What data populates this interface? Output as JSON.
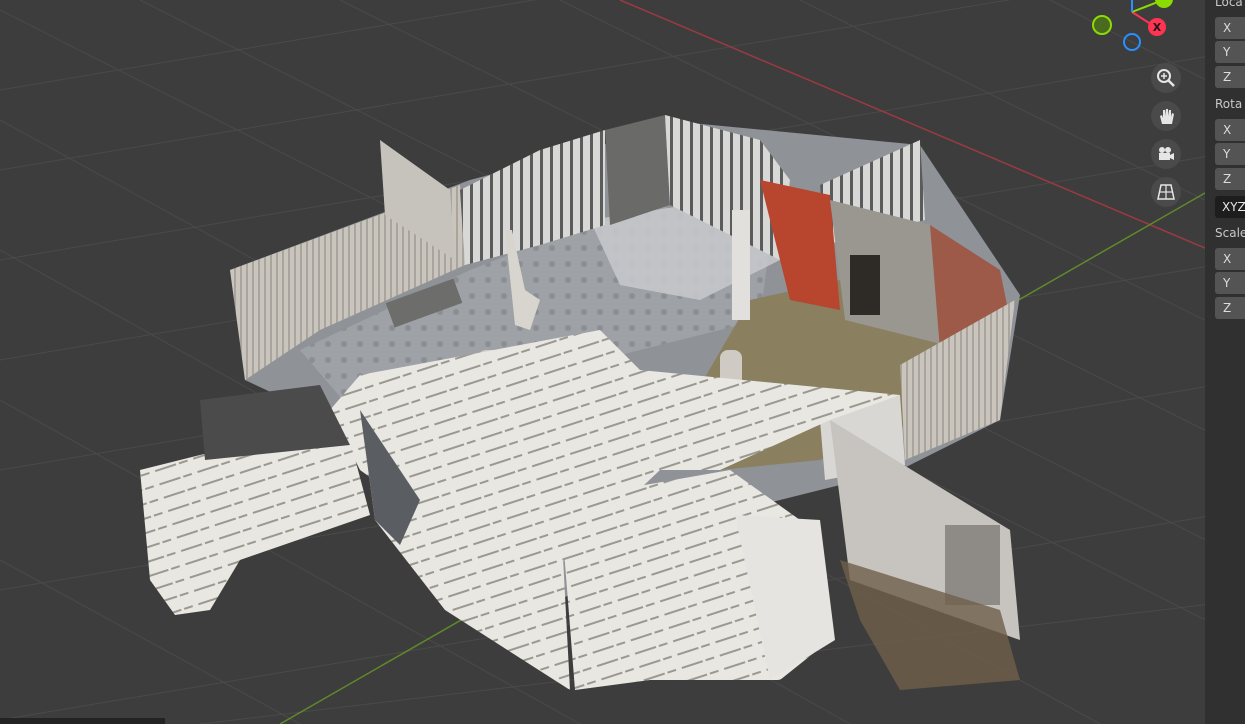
{
  "gizmo": {
    "x_axis_label": "X",
    "colors": {
      "x": "#ff3352",
      "y": "#8bdc00",
      "z": "#2890ff"
    }
  },
  "nav_buttons": [
    {
      "icon": "zoom-icon",
      "glyph": "⊕"
    },
    {
      "icon": "hand-pan-icon",
      "glyph": "✋"
    },
    {
      "icon": "camera-icon",
      "glyph": "🎥"
    },
    {
      "icon": "grid-ortho-icon",
      "glyph": "▦"
    }
  ],
  "properties": {
    "location": {
      "label": "Loca",
      "fields": [
        "X",
        "Y",
        "Z"
      ]
    },
    "rotation": {
      "label": "Rota",
      "fields": [
        "X",
        "Y",
        "Z"
      ],
      "mode": "XYZ"
    },
    "scale": {
      "label": "Scale",
      "fields": [
        "X",
        "Y",
        "Z"
      ]
    }
  }
}
